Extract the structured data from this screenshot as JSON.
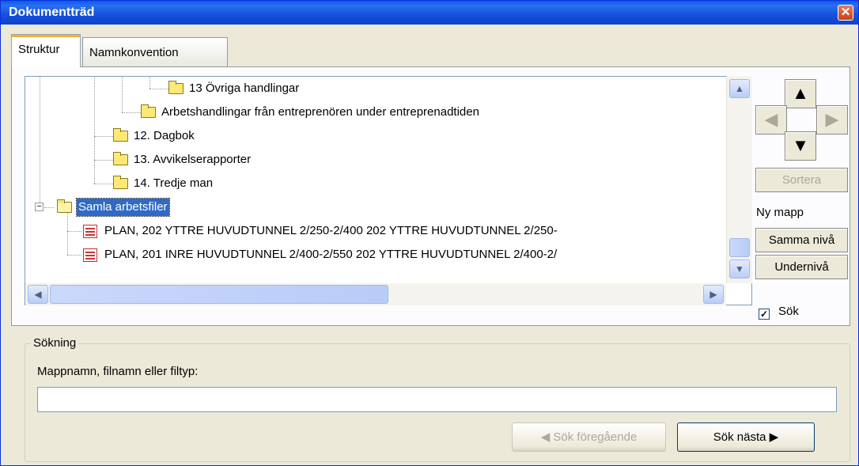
{
  "window": {
    "title": "Dokumentträd"
  },
  "tabs": [
    {
      "label": "Struktur",
      "active": true
    },
    {
      "label": "Namnkonvention",
      "active": false
    }
  ],
  "tree": {
    "items": [
      {
        "label": "13 Övriga handlingar",
        "type": "folder"
      },
      {
        "label": "Arbetshandlingar från entreprenören under entreprenadtiden",
        "type": "folder"
      },
      {
        "label": "12. Dagbok",
        "type": "folder"
      },
      {
        "label": "13. Avvikelserapporter",
        "type": "folder"
      },
      {
        "label": "14. Tredje man",
        "type": "folder"
      },
      {
        "label": "Samla arbetsfiler",
        "type": "folder",
        "selected": true,
        "expanded": true
      },
      {
        "label": "PLAN, 202 YTTRE HUVUDTUNNEL 2/250-2/400 202 YTTRE HUVUDTUNNEL 2/250-",
        "type": "file"
      },
      {
        "label": "PLAN, 201 INRE HUVUDTUNNEL 2/400-2/550 202 YTTRE HUVUDTUNNEL 2/400-2/",
        "type": "file"
      }
    ]
  },
  "side": {
    "sort_label": "Sortera",
    "new_folder_label": "Ny mapp",
    "same_level_label": "Samma nivå",
    "sub_level_label": "Undernivå",
    "search_checkbox_label": "Sök",
    "search_checked": true
  },
  "search": {
    "group_title": "Sökning",
    "field_label": "Mappnamn, filnamn eller filtyp:",
    "value": "",
    "prev_label": "Sök föregående",
    "next_label": "Sök nästa"
  }
}
